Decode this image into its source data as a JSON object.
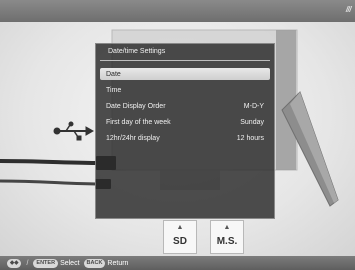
{
  "menu": {
    "title": "Date/time Settings",
    "items": [
      {
        "label": "Date",
        "value": ""
      },
      {
        "label": "Time",
        "value": ""
      },
      {
        "label": "Date Display Order",
        "value": "M-D-Y"
      },
      {
        "label": "First day of the week",
        "value": "Sunday"
      },
      {
        "label": "12hr/24hr display",
        "value": "12 hours"
      }
    ],
    "selected_index": 0
  },
  "slots": {
    "sd": "SD",
    "ms": "M.S."
  },
  "footer": {
    "nav_key": "◆◆",
    "enter_key": "ENTER",
    "select_label": "Select",
    "back_key": "BACK",
    "return_label": "Return"
  },
  "colors": {
    "panel": "#282828",
    "highlight": "#e0e0e0",
    "bar": "#6e6e6e"
  },
  "icons": [
    "usb-icon",
    "up-arrow-icon"
  ]
}
